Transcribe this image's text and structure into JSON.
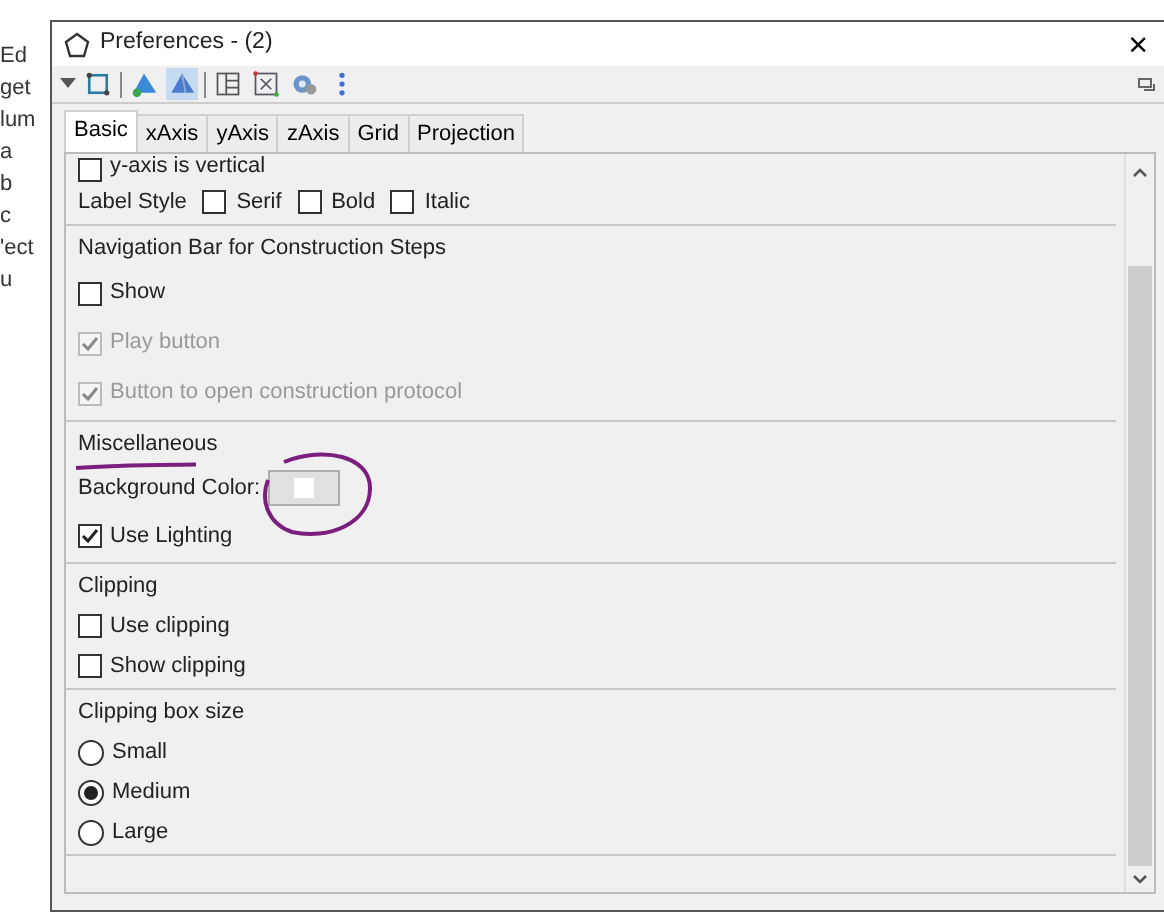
{
  "background_window": {
    "fragments": [
      "Ed",
      "get",
      "lum",
      "a",
      "b",
      "c",
      "'ect",
      "u"
    ]
  },
  "window": {
    "title": "Preferences - (2)",
    "close": "×"
  },
  "toolbar": {
    "buttons": [
      {
        "kind": "cube",
        "selected": false
      },
      {
        "kind": "sep"
      },
      {
        "kind": "pyramid",
        "selected": false
      },
      {
        "kind": "pyramid-blue",
        "selected": true
      },
      {
        "kind": "sep"
      },
      {
        "kind": "layout",
        "selected": false
      },
      {
        "kind": "grid",
        "selected": false
      },
      {
        "kind": "gear",
        "selected": false
      },
      {
        "kind": "dots",
        "selected": false
      }
    ]
  },
  "tabs": [
    {
      "label": "Basic",
      "selected": true
    },
    {
      "label": "xAxis",
      "selected": false
    },
    {
      "label": "yAxis",
      "selected": false
    },
    {
      "label": "zAxis",
      "selected": false
    },
    {
      "label": "Grid",
      "selected": false
    },
    {
      "label": "Projection",
      "selected": false
    }
  ],
  "sections": [
    {
      "items": [
        {
          "kind": "checkbox",
          "label": "y-axis is vertical",
          "checked": false,
          "disabled": false
        },
        {
          "kind": "style",
          "label": "Label Style",
          "options": [
            {
              "label": "Serif",
              "checked": false
            },
            {
              "label": "Bold",
              "checked": false
            },
            {
              "label": "Italic",
              "checked": false
            }
          ]
        }
      ]
    },
    {
      "title": "Navigation Bar for Construction Steps",
      "items": [
        {
          "kind": "checkbox",
          "label": "Show",
          "checked": false,
          "disabled": false,
          "children": [
            {
              "kind": "checkbox",
              "label": "Play button",
              "checked": true,
              "disabled": true
            },
            {
              "kind": "checkbox",
              "label": "Button to open construction protocol",
              "checked": true,
              "disabled": true
            }
          ]
        }
      ]
    },
    {
      "title": "Miscellaneous",
      "items": [
        {
          "kind": "color",
          "label": "Background Color:",
          "color": "#ffffff"
        },
        {
          "kind": "checkbox",
          "label": "Use Lighting",
          "checked": true,
          "disabled": false
        }
      ]
    },
    {
      "title": "Clipping",
      "items": [
        {
          "kind": "checkbox",
          "label": "Use clipping",
          "checked": false,
          "disabled": false
        },
        {
          "kind": "checkbox",
          "label": "Show clipping",
          "checked": false,
          "disabled": false
        }
      ]
    },
    {
      "title": "Clipping box size",
      "items": [
        {
          "kind": "radio",
          "label": "Small",
          "selected": false
        },
        {
          "kind": "radio",
          "label": "Medium",
          "selected": true
        },
        {
          "kind": "radio",
          "label": "Large",
          "selected": false
        }
      ]
    }
  ]
}
